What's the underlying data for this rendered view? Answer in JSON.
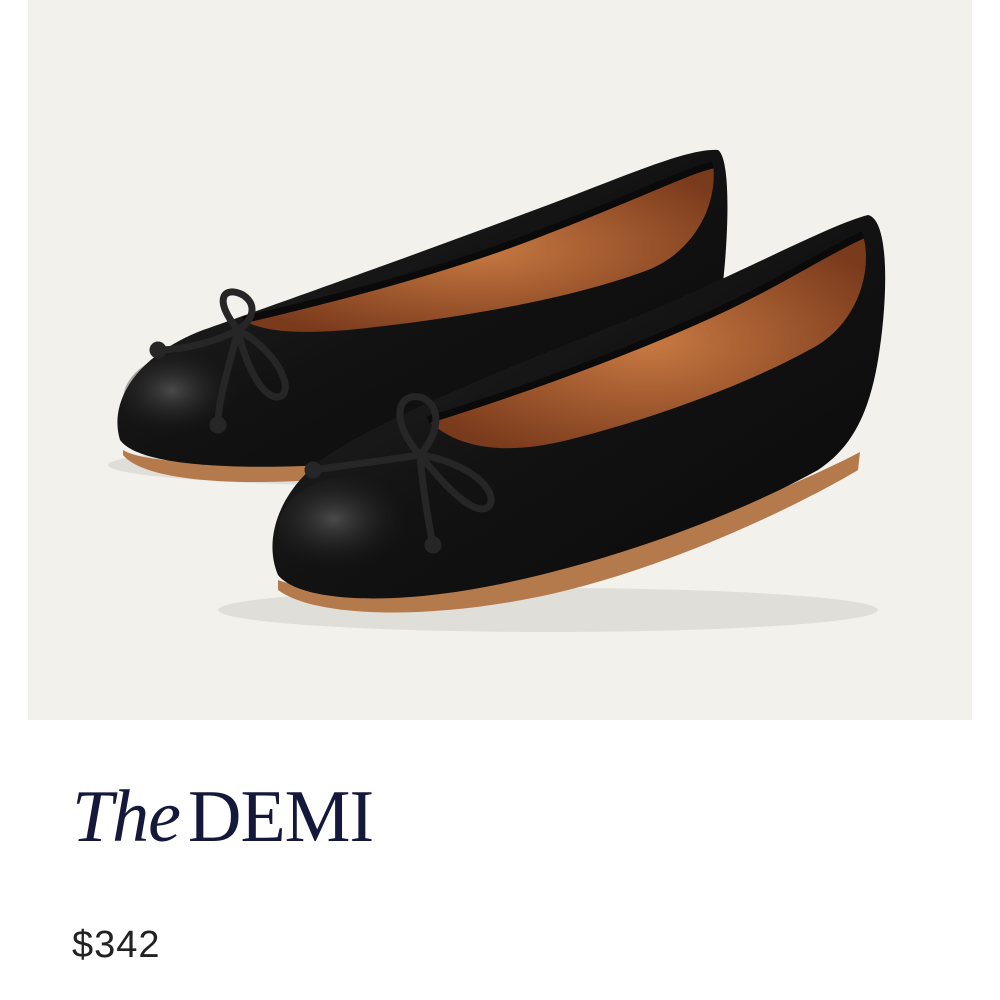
{
  "product": {
    "image_icon": "ballet-flats-photo",
    "title_prefix": "The",
    "title_name": "DEMI",
    "price": "$342"
  },
  "colors": {
    "background": "#ffffff",
    "image_background": "#f3f1ec",
    "title": "#14183a",
    "price": "#222222",
    "leather": "#141414",
    "lining": "#a75c2f",
    "sole": "#b57a4c"
  }
}
